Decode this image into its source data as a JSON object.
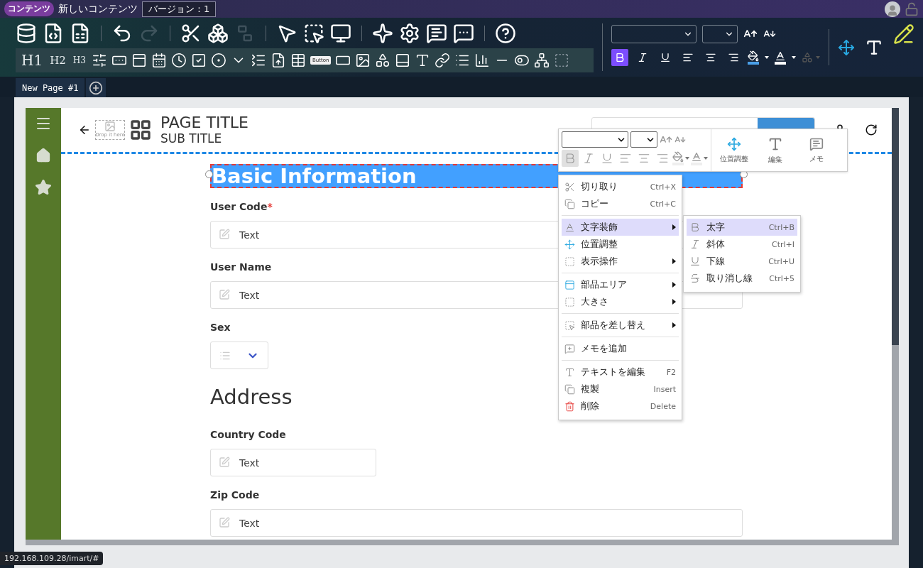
{
  "topbar": {
    "badge": "コンテンツ",
    "title": "新しいコンテンツ",
    "version": "バージョン：1"
  },
  "toolbar": {
    "groups": [
      [
        {
          "kind": "db-export",
          "disabled": false
        },
        {
          "kind": "html",
          "disabled": false
        },
        {
          "kind": "sheet-download",
          "disabled": false
        }
      ],
      [
        {
          "kind": "undo",
          "disabled": false
        },
        {
          "kind": "redo",
          "disabled": true
        }
      ],
      [
        {
          "kind": "cut",
          "disabled": false
        },
        {
          "kind": "group",
          "disabled": false
        },
        {
          "kind": "ungroup",
          "disabled": true
        }
      ],
      [
        {
          "kind": "pointer",
          "disabled": false
        },
        {
          "kind": "area-select",
          "disabled": false
        },
        {
          "kind": "monitor",
          "disabled": false
        }
      ],
      [
        {
          "kind": "sparkle",
          "disabled": false
        },
        {
          "kind": "area-settings",
          "disabled": false
        },
        {
          "kind": "comment-edit",
          "disabled": false
        },
        {
          "kind": "comment-settings",
          "disabled": false
        }
      ],
      [
        {
          "kind": "help",
          "disabled": false
        }
      ]
    ],
    "parts": [
      {
        "kind": "large-text",
        "label": "H1"
      },
      {
        "kind": "medium-text",
        "label": "H2"
      },
      {
        "kind": "small-text",
        "label": "H3"
      },
      {
        "kind": "slider"
      },
      {
        "kind": "spinner"
      },
      {
        "kind": "textarea"
      },
      {
        "kind": "calendar"
      },
      {
        "kind": "clock"
      },
      {
        "kind": "checkbox"
      },
      {
        "kind": "radio"
      },
      {
        "kind": "select"
      },
      {
        "kind": "listbox"
      },
      {
        "kind": "upload"
      },
      {
        "kind": "table"
      },
      {
        "kind": "chip",
        "label": "Button"
      },
      {
        "kind": "bar"
      },
      {
        "kind": "image"
      },
      {
        "kind": "shapes"
      },
      {
        "kind": "panel"
      },
      {
        "kind": "type"
      },
      {
        "kind": "link"
      },
      {
        "kind": "list"
      },
      {
        "kind": "chart"
      },
      {
        "kind": "rule"
      },
      {
        "kind": "toggle"
      },
      {
        "kind": "tree"
      },
      {
        "kind": "dashed"
      }
    ],
    "format": [
      {
        "kind": "bold",
        "selected": true
      },
      {
        "kind": "italic",
        "selected": false
      },
      {
        "kind": "underline",
        "selected": false
      },
      {
        "kind": "align-left",
        "selected": false
      },
      {
        "kind": "align-center",
        "selected": false
      },
      {
        "kind": "align-right",
        "selected": false
      }
    ],
    "extra_disabled": true
  },
  "tabs": [
    {
      "label": "New Page #1",
      "selected": true
    }
  ],
  "page": {
    "title": "PAGE TITLE",
    "subtitle": "SUB TITLE",
    "image_hint": "Drop it here",
    "form": [
      {
        "kind": "heading",
        "label": "Basic Information",
        "selected": true
      },
      {
        "kind": "text",
        "label": "User Code",
        "required_mark": "*",
        "placeholder": "Text"
      },
      {
        "kind": "text",
        "label": "User Name",
        "placeholder": "Text"
      },
      {
        "kind": "select",
        "label": "Sex"
      },
      {
        "kind": "section",
        "label": "Address",
        "selected": false
      },
      {
        "kind": "short",
        "label": "Country Code",
        "placeholder": "Text"
      },
      {
        "kind": "text",
        "label": "Zip Code",
        "placeholder": "Text"
      }
    ]
  },
  "float_toolbar": {
    "format": [
      {
        "kind": "bold",
        "selected": true
      },
      {
        "kind": "italic",
        "selected": false
      },
      {
        "kind": "underline",
        "selected": false
      },
      {
        "kind": "align-left",
        "selected": false
      },
      {
        "kind": "align-center",
        "selected": false
      },
      {
        "kind": "align-right",
        "selected": false
      }
    ],
    "actions": [
      {
        "kind": "move",
        "label": "位置調整"
      },
      {
        "kind": "text",
        "label": "編集"
      },
      {
        "kind": "memo",
        "label": "メモ"
      }
    ]
  },
  "context_menu": {
    "groups": [
      [
        {
          "kind": "cut",
          "label": "切り取り",
          "shortcut": "Ctrl+X",
          "submenu": false,
          "selected": false
        },
        {
          "kind": "copy",
          "label": "コピー",
          "shortcut": "Ctrl+C",
          "submenu": false,
          "selected": false
        }
      ],
      [
        {
          "kind": "font",
          "label": "文字装飾",
          "submenu": true,
          "selected": true
        },
        {
          "kind": "move",
          "label": "位置調整",
          "submenu": false,
          "selected": false
        },
        {
          "kind": "dashed",
          "label": "表示操作",
          "submenu": true,
          "selected": false
        }
      ],
      [
        {
          "kind": "area",
          "label": "部品エリア",
          "submenu": true,
          "selected": false
        },
        {
          "kind": "dashed",
          "label": "大きさ",
          "submenu": true,
          "selected": false
        }
      ],
      [
        {
          "kind": "replace",
          "label": "部品を差し替え",
          "submenu": true,
          "selected": false
        }
      ],
      [
        {
          "kind": "memo",
          "label": "メモを追加",
          "submenu": false,
          "selected": false
        }
      ],
      [
        {
          "kind": "text",
          "label": "テキストを編集",
          "shortcut": "F2",
          "submenu": false,
          "selected": false
        },
        {
          "kind": "copy",
          "label": "複製",
          "shortcut": "Insert",
          "submenu": false,
          "selected": false
        },
        {
          "kind": "delete",
          "label": "削除",
          "shortcut": "Delete",
          "submenu": false,
          "selected": false
        }
      ]
    ]
  },
  "submenu": [
    {
      "kind": "bold",
      "label": "太字",
      "shortcut": "Ctrl+B",
      "selected": true
    },
    {
      "kind": "italic",
      "label": "斜体",
      "shortcut": "Ctrl+I",
      "selected": false
    },
    {
      "kind": "underline",
      "label": "下線",
      "shortcut": "Ctrl+U",
      "selected": false
    },
    {
      "kind": "strike",
      "label": "取り消し線",
      "shortcut": "Ctrl+5",
      "selected": false
    }
  ],
  "status_url": "192.168.109.28/imart/#"
}
